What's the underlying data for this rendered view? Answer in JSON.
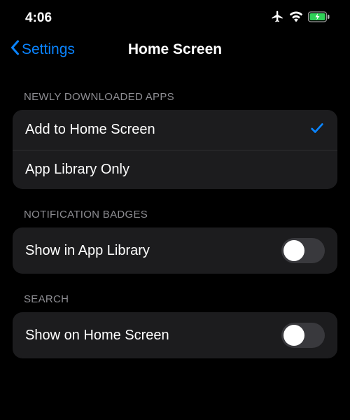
{
  "status_bar": {
    "time": "4:06",
    "icons": {
      "airplane": "airplane-icon",
      "wifi": "wifi-icon",
      "battery": "battery-charging-icon"
    }
  },
  "nav": {
    "back_label": "Settings",
    "title": "Home Screen"
  },
  "sections": {
    "newly_downloaded": {
      "header": "Newly Downloaded Apps",
      "options": {
        "add_home": {
          "label": "Add to Home Screen",
          "selected": true
        },
        "app_library_only": {
          "label": "App Library Only",
          "selected": false
        }
      }
    },
    "notification_badges": {
      "header": "Notification Badges",
      "show_in_app_library": {
        "label": "Show in App Library",
        "on": false
      }
    },
    "search": {
      "header": "Search",
      "show_on_home_screen": {
        "label": "Show on Home Screen",
        "on": false
      }
    }
  },
  "colors": {
    "accent": "#0a84ff",
    "battery_green": "#30d158"
  }
}
